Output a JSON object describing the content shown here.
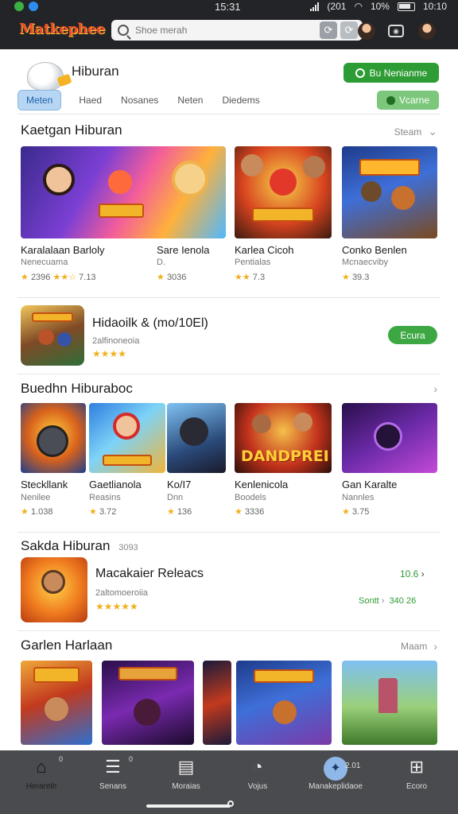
{
  "status_bar": {
    "time": "15:31",
    "right_text": "(201",
    "battery_text": "10%",
    "clock2": "10:10"
  },
  "header": {
    "logo": "Matkephee",
    "search_placeholder": "Shoe merah"
  },
  "page": {
    "title": "Hiburan",
    "green_button": "Bu Nenianme",
    "tabs": [
      "Meten",
      "Haed",
      "Nosanes",
      "Neten",
      "Diedems"
    ],
    "active_tab": 0,
    "tab_button": "Vcarne"
  },
  "section1": {
    "title": "Kaetgan Hiburan",
    "see_all": "Steam",
    "cards": [
      {
        "name": "Karalalaan Barloly",
        "sub": "Nenecuama",
        "rating_a": "2396",
        "rating_b": "7.13"
      },
      {
        "name": "Sare Ienola",
        "sub": "D.",
        "rating": "3036"
      },
      {
        "name": "Karlea Cicoh",
        "sub": "Pentialas",
        "rating": "7.3"
      },
      {
        "name": "Conko Benlen",
        "sub": "Mcnaecviby",
        "rating": "39.3"
      }
    ]
  },
  "featured": {
    "title": "Hidaoilk & (mo/10El)",
    "sub": "2alfinoneoia",
    "button": "Ecura"
  },
  "section2": {
    "title": "Buedhn Hiburaboc",
    "cards": [
      {
        "name": "Steckllank",
        "sub": "Nenilee",
        "rating": "1.038"
      },
      {
        "name": "Gaetlianola",
        "sub": "Reasins",
        "rating": "3.72"
      },
      {
        "name": "Ko/I7",
        "sub": "Dnn",
        "rating": "136"
      },
      {
        "name": "Kenlenicola",
        "sub": "Boodels",
        "rating": "3336"
      },
      {
        "name": "Gan Karalte",
        "sub": "Nannles",
        "rating": "3.75"
      }
    ],
    "banner_text": "DANDPREI"
  },
  "section3": {
    "title": "Sakda Hiburan",
    "badge": "3093",
    "item": {
      "title": "Macakaier Releacs",
      "sub": "2altomoeroiia",
      "price": "10.6",
      "sort_label": "Sontt",
      "price2": "340",
      "price3": "26"
    }
  },
  "section4": {
    "title": "Garlen Harlaan",
    "see_all": "Maam"
  },
  "bottom_nav": [
    {
      "label": "Herareih",
      "icon": "home-icon",
      "badge": "0"
    },
    {
      "label": "Senans",
      "icon": "stack-icon",
      "badge": "0"
    },
    {
      "label": "Moraias",
      "icon": "list-icon"
    },
    {
      "label": "Vojus",
      "icon": "gauge-icon"
    },
    {
      "label": "Manakeplidaoe",
      "icon": "game-icon",
      "badge": "2.01"
    },
    {
      "label": "Ecoro",
      "icon": "grid-icon"
    }
  ],
  "colors": {
    "green": "#2e9c35",
    "header": "#222427",
    "nav": "#4a4b4e",
    "star": "#f0b01e",
    "tab_active": "#b7d6f4"
  }
}
